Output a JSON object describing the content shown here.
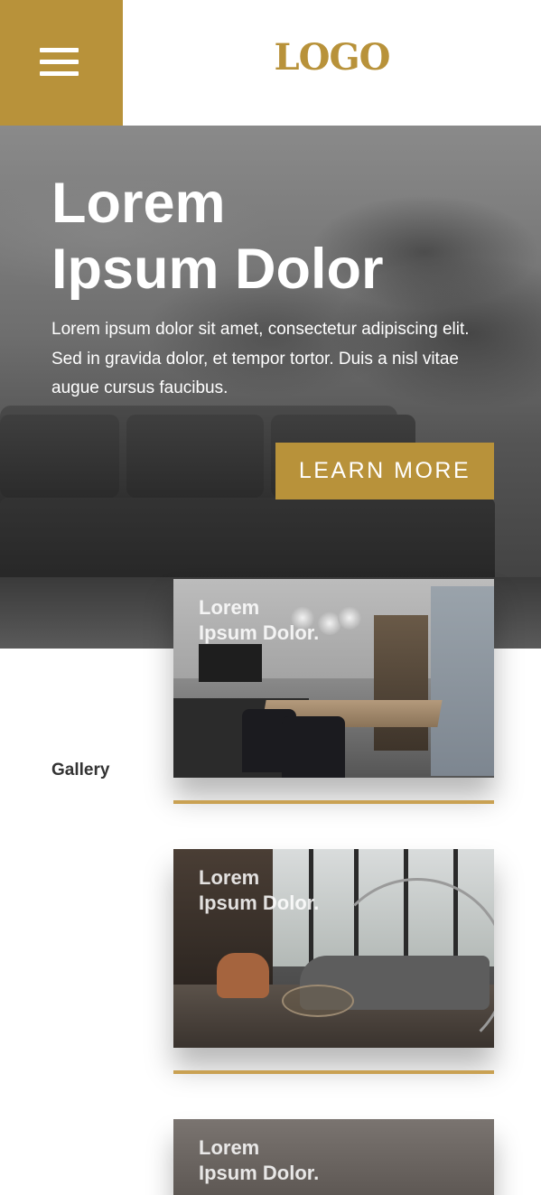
{
  "header": {
    "logo_text": "LOGO",
    "menu_icon": "hamburger-icon"
  },
  "hero": {
    "title_line1": "Lorem",
    "title_line2": "Ipsum Dolor",
    "body": "Lorem ipsum dolor sit amet, consectetur adipiscing elit. Sed in gravida dolor, et tempor tortor. Duis a nisl vitae augue cursus faucibus.",
    "cta_label": "LEARN MORE"
  },
  "gallery": {
    "label": "Gallery",
    "cards": [
      {
        "title_line1": "Lorem",
        "title_line2": "Ipsum Dolor."
      },
      {
        "title_line1": "Lorem",
        "title_line2": "Ipsum Dolor."
      },
      {
        "title_line1": "Lorem",
        "title_line2": "Ipsum Dolor."
      }
    ]
  },
  "colors": {
    "accent": "#b8923a",
    "divider": "#c9a153",
    "text_dark": "#333333"
  }
}
